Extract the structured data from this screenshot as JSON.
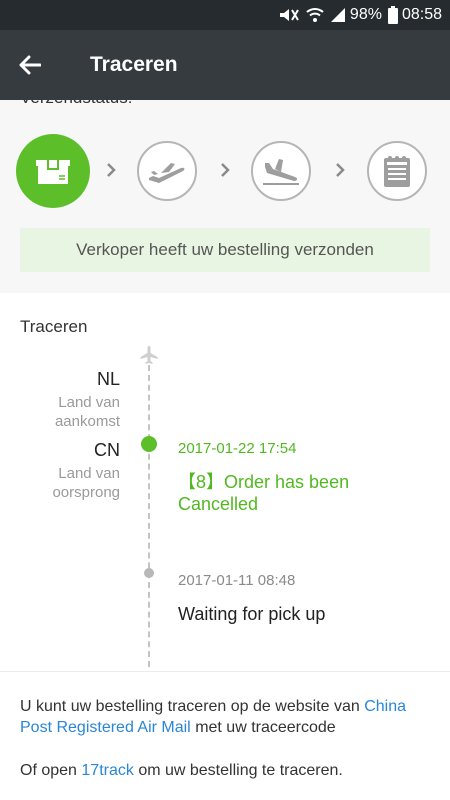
{
  "status_bar": {
    "battery": "98%",
    "time": "08:58",
    "icons": [
      "mute-icon",
      "wifi-icon",
      "signal-icon",
      "battery-icon"
    ]
  },
  "app_bar": {
    "title": "Traceren",
    "back_icon": "arrow-left-icon"
  },
  "status_section": {
    "heading": "Verzendstatus:",
    "steps": [
      {
        "icon": "package-icon",
        "active": true
      },
      {
        "icon": "plane-takeoff-icon",
        "active": false
      },
      {
        "icon": "plane-landing-icon",
        "active": false
      },
      {
        "icon": "notepad-icon",
        "active": false
      }
    ],
    "banner": "Verkoper heeft uw bestelling verzonden",
    "colors": {
      "active": "#5cbf2a",
      "banner_bg": "#e8f5e2"
    }
  },
  "tracking": {
    "title": "Traceren",
    "destination": {
      "code": "NL",
      "label": "Land van aankomst"
    },
    "origin": {
      "code": "CN",
      "label": "Land van oorsprong"
    },
    "events": [
      {
        "time": "2017-01-22 17:54",
        "description": "【8】Order has been Cancelled",
        "status": "latest"
      },
      {
        "time": "2017-01-11 08:48",
        "description": "Waiting for pick up",
        "status": "past"
      }
    ]
  },
  "info": {
    "line1_prefix": "U kunt uw bestelling traceren op de website van",
    "carrier_link": "China Post Registered Air Mail",
    "line1_suffix": "met uw traceercode",
    "line2_prefix": "Of open",
    "app_link": "17track",
    "line2_suffix": "om uw bestelling te traceren."
  }
}
